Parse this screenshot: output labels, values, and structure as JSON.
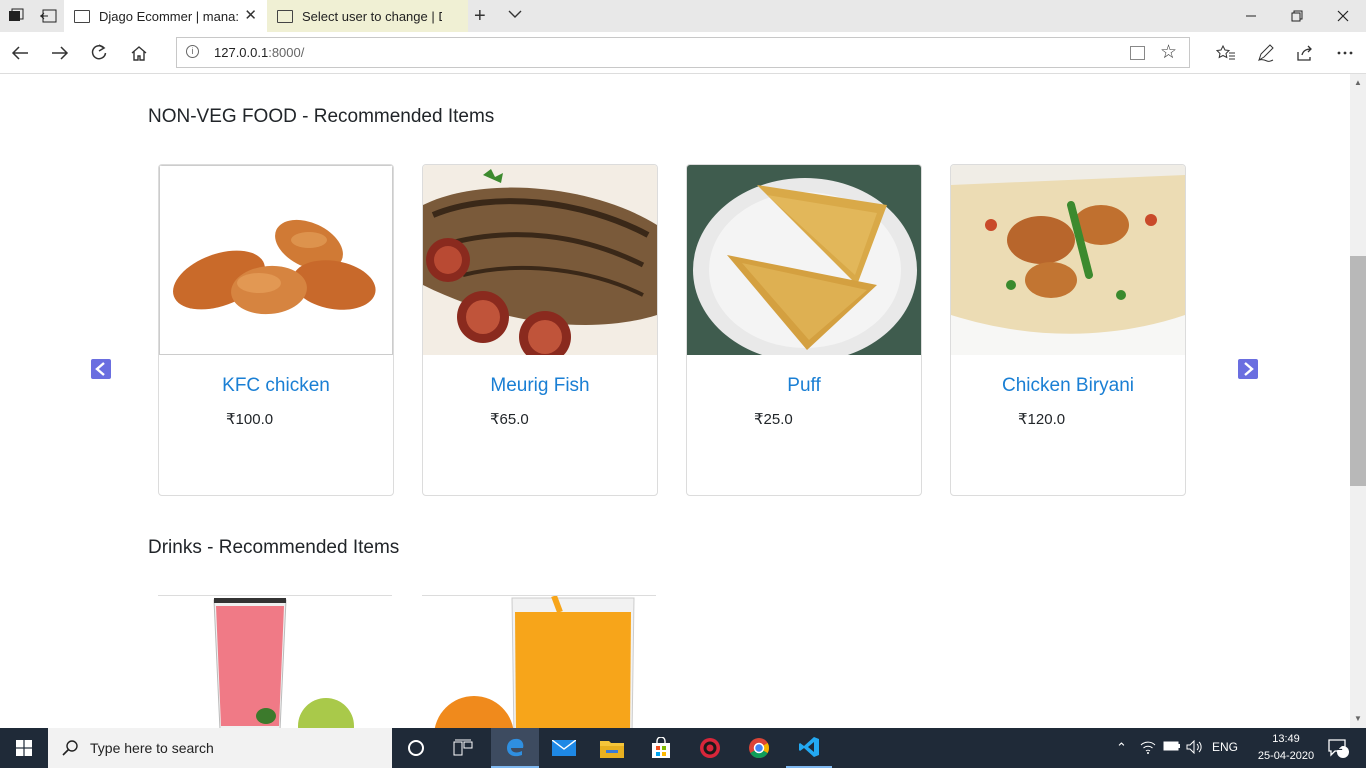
{
  "browser": {
    "tabs": [
      {
        "label": "Djago Ecommer | mana:"
      },
      {
        "label": "Select user to change | Djan"
      }
    ],
    "url_host": "127.0.0.1",
    "url_rest": ":8000/"
  },
  "sections": [
    {
      "title": "NON-VEG FOOD - Recommended Items",
      "items": [
        {
          "name": "KFC chicken",
          "price": "₹100.0"
        },
        {
          "name": "Meurig Fish",
          "price": "₹65.0"
        },
        {
          "name": "Puff",
          "price": "₹25.0"
        },
        {
          "name": "Chicken Biryani",
          "price": "₹120.0"
        }
      ]
    },
    {
      "title": "Drinks - Recommended Items",
      "items": [
        {
          "name": "",
          "price": ""
        },
        {
          "name": "",
          "price": ""
        }
      ]
    }
  ],
  "taskbar": {
    "search_placeholder": "Type here to search",
    "language": "ENG",
    "time": "13:49",
    "date": "25-04-2020",
    "notification_count": "2"
  },
  "colors": {
    "link": "#1a7fd4",
    "carousel_arrow": "#6a6ee0",
    "taskbar": "#1f2a38"
  }
}
